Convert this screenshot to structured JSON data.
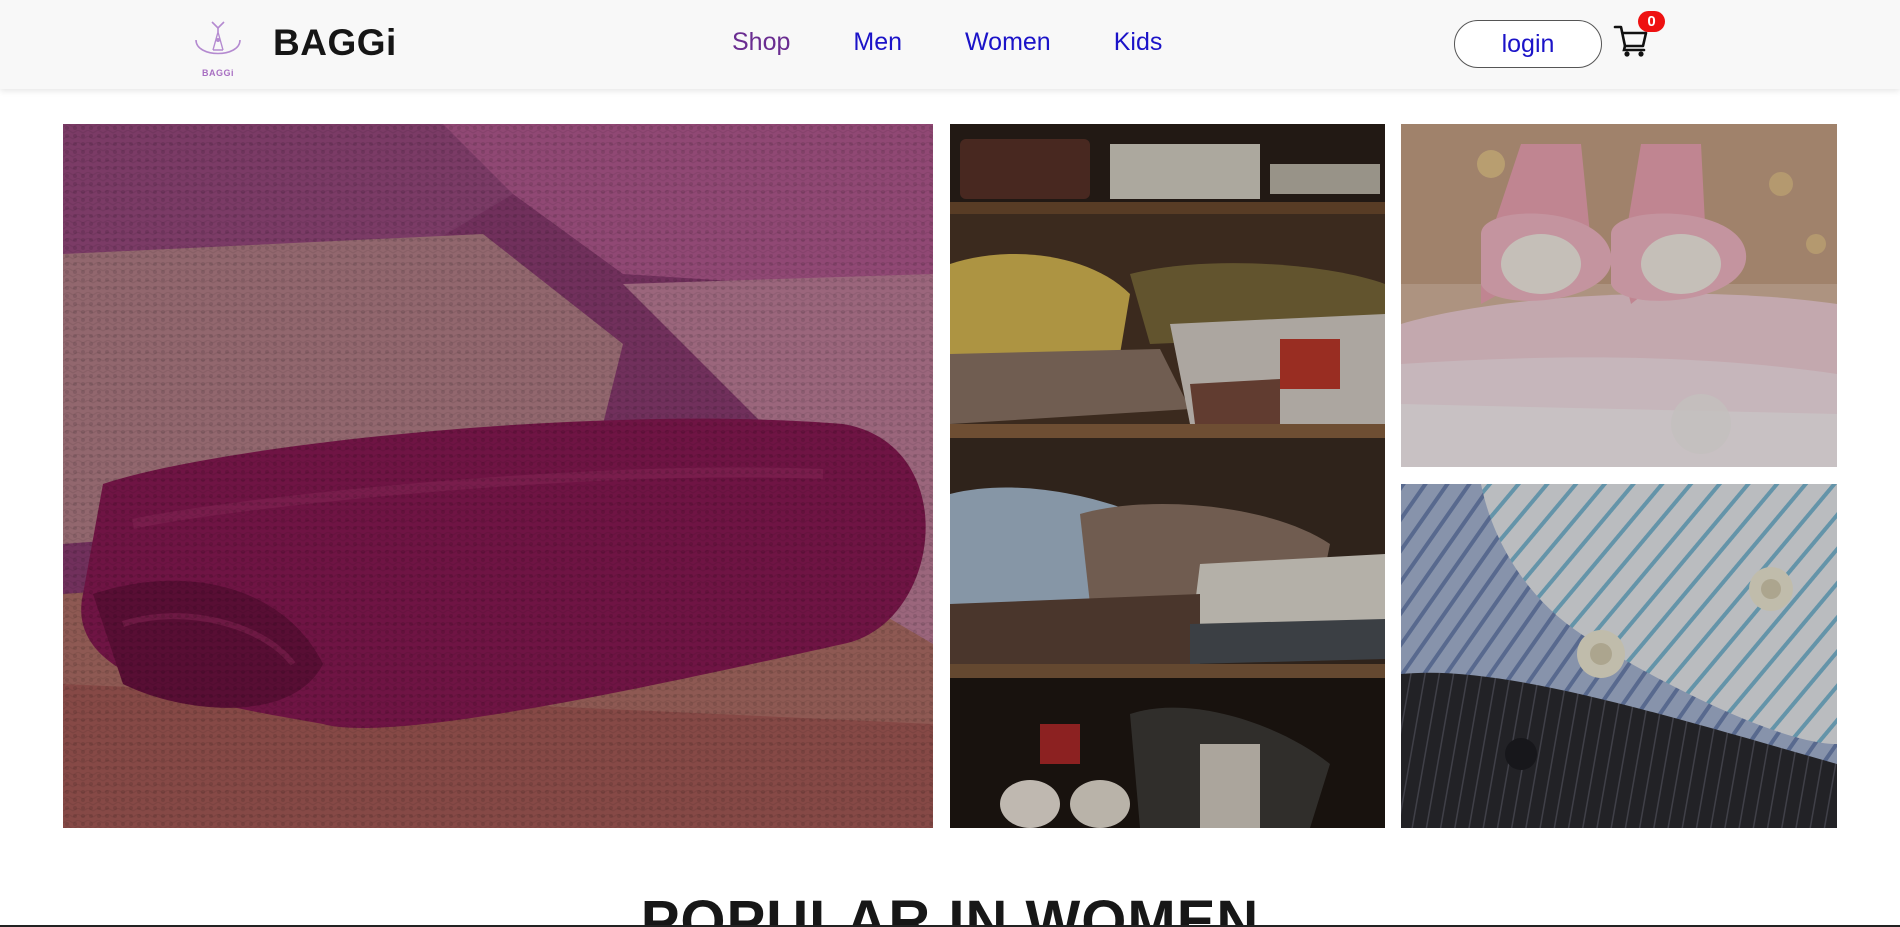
{
  "header": {
    "logo_small_text": "BAGGi",
    "brand_name": "BAGGi",
    "nav": [
      {
        "label": "Shop",
        "active": true
      },
      {
        "label": "Men",
        "active": false
      },
      {
        "label": "Women",
        "active": false
      },
      {
        "label": "Kids",
        "active": false
      }
    ],
    "login_label": "login",
    "cart_count": "0",
    "icons": {
      "logo": "hanger-logo-icon",
      "cart": "shopping-cart-icon"
    }
  },
  "hero": {
    "tiles": [
      {
        "subject": "folded knit blankets"
      },
      {
        "subject": "wardrobe shelves with clothes"
      },
      {
        "subject": "pink baby booties"
      },
      {
        "subject": "striped shirts"
      }
    ]
  },
  "section": {
    "title": "POPULAR IN WOMEN"
  },
  "colors": {
    "nav_link": "#1b13c8",
    "nav_active": "#6a2d91",
    "badge": "#ee1111",
    "header_bg": "#f8f8f8"
  }
}
